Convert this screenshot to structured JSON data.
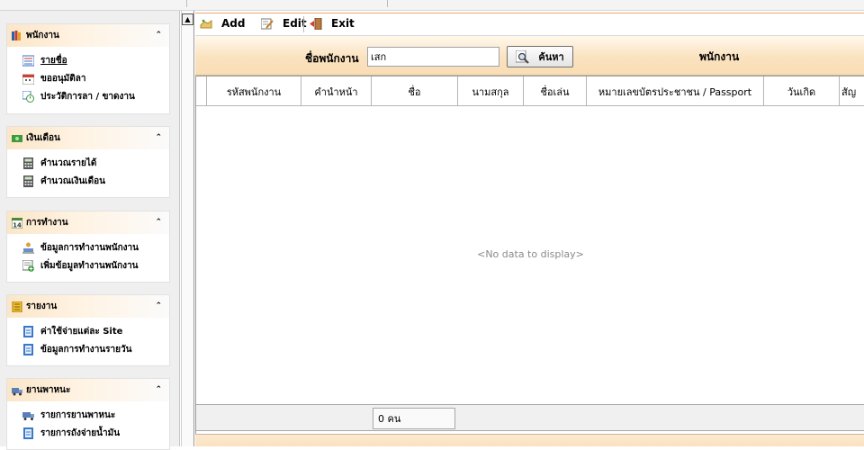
{
  "sidebar": {
    "panels": [
      {
        "title": "พนักงาน",
        "icon": "books-icon",
        "items": [
          {
            "label": "รายชื่อ",
            "icon": "list-icon",
            "link": true
          },
          {
            "label": "ขออนุมัติลา",
            "icon": "calendar-icon"
          },
          {
            "label": "ประวัติการลา / ขาดงาน",
            "icon": "history-icon"
          }
        ]
      },
      {
        "title": "เงินเดือน",
        "icon": "money-icon",
        "items": [
          {
            "label": "คำนวณรายได้",
            "icon": "calculator-icon"
          },
          {
            "label": "คำนวณเงินเดือน",
            "icon": "calculator-icon"
          }
        ]
      },
      {
        "title": "การทำงาน",
        "icon": "calendar-14-icon",
        "items": [
          {
            "label": "ข้อมูลการทำงานพนักงาน",
            "icon": "worker-icon"
          },
          {
            "label": "เพิ่มข้อมูลทำงานพนักงาน",
            "icon": "add-record-icon"
          }
        ]
      },
      {
        "title": "รายงาน",
        "icon": "report-icon",
        "items": [
          {
            "label": "ค่าใช้จ่ายแต่ละ Site",
            "icon": "report-book-icon"
          },
          {
            "label": "ข้อมูลการทำงานรายวัน",
            "icon": "report-book-icon"
          }
        ]
      },
      {
        "title": "ยานพาหนะ",
        "icon": "truck-icon",
        "items": [
          {
            "label": "รายการยานพาหนะ",
            "icon": "truck-icon"
          },
          {
            "label": "รายการถังจ่ายน้ำมัน",
            "icon": "fuel-book-icon"
          }
        ]
      }
    ],
    "collapse_glyph": "⌃"
  },
  "toolbar": {
    "add_label": "Add",
    "edit_label": "Edit",
    "exit_label": "Exit"
  },
  "search": {
    "label": "ชื่อพนักงาน",
    "value": "เสก",
    "button_label": "ค้นหา",
    "section_title": "พนักงาน"
  },
  "grid": {
    "columns": [
      "รหัสพนักงาน",
      "คำนำหน้า",
      "ชื่อ",
      "นามสกุล",
      "ชื่อเล่น",
      "หมายเลขบัตรประชาชน / Passport",
      "วันเกิด",
      "สัญ"
    ],
    "empty_text": "<No data to display>",
    "footer_count": "0 คน"
  },
  "colors": {
    "accent_orange": "#fbe2bf",
    "toolbar_border": "#e8a86a"
  }
}
